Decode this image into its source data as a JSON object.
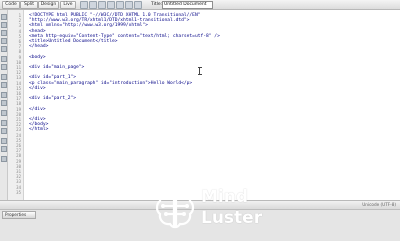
{
  "toolbar": {
    "code_label": "Code",
    "split_label": "Split",
    "design_label": "Design",
    "live_label": "Live",
    "title_label": "Title:",
    "title_value": "Untitled Document"
  },
  "editor": {
    "line_numbers": [
      "1",
      "2",
      "3",
      "4",
      "5",
      "6",
      "7",
      "8",
      "9",
      "10",
      "11",
      "12",
      "13",
      "14",
      "15",
      "16",
      "17",
      "18",
      "19",
      "20",
      "21",
      "22",
      "23",
      "24",
      "25",
      "26",
      "27",
      "28",
      "29",
      "30",
      "31",
      "32",
      "33",
      "34",
      "35"
    ],
    "lines": [
      "<!DOCTYPE html PUBLIC \"-//W3C//DTD XHTML 1.0 Transitional//EN\"",
      "\"http://www.w3.org/TR/xhtml1/DTD/xhtml1-transitional.dtd\">",
      "<html xmlns=\"http://www.w3.org/1999/xhtml\">",
      "<head>",
      "<meta http-equiv=\"Content-Type\" content=\"text/html; charset=utf-8\" />",
      "<title>Untitled Document</title>",
      "</head>",
      "",
      "<body>",
      "",
      "<div id=\"main_page\">",
      "",
      "<div id=\"part_1\">",
      "<p class=\"main_paragraph\" id=\"introduction\">Hello World</p>",
      "</div>",
      "",
      "<div id=\"part_2\">",
      "",
      "</div>",
      "",
      "</div>",
      "</body>",
      "</html>"
    ]
  },
  "status": {
    "encoding": "Unicode (UTF-8)"
  },
  "properties": {
    "tab_label": "Properties"
  },
  "watermark": {
    "line1": "Mind",
    "line2": "Luster"
  },
  "colors": {
    "code_text": "#000085",
    "logo_text": "#ffffff",
    "logo_icon": "#ffffff"
  }
}
